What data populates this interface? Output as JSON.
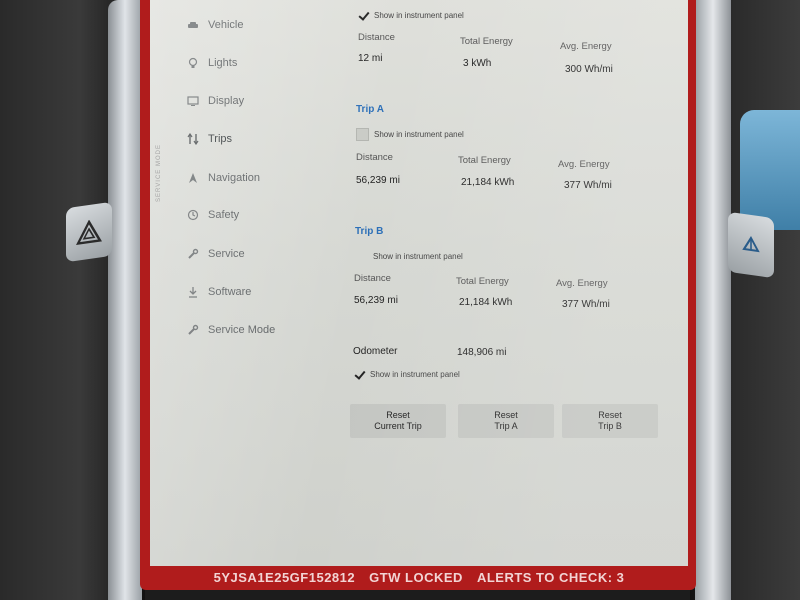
{
  "status_bar": {
    "vin": "5YJSA1E25GF152812",
    "gateway": "GTW LOCKED",
    "alerts": "ALERTS TO CHECK: 3"
  },
  "side_rail_text": "SERVICE MODE",
  "sidebar": {
    "items": [
      {
        "label": "Vehicle",
        "icon": "car-icon"
      },
      {
        "label": "Lights",
        "icon": "light-bulb-icon"
      },
      {
        "label": "Display",
        "icon": "display-icon"
      },
      {
        "label": "Trips",
        "icon": "trips-icon",
        "active": true
      },
      {
        "label": "Navigation",
        "icon": "navigation-arrow-icon"
      },
      {
        "label": "Safety",
        "icon": "safety-icon"
      },
      {
        "label": "Service",
        "icon": "wrench-icon"
      },
      {
        "label": "Software",
        "icon": "download-icon"
      },
      {
        "label": "Service Mode",
        "icon": "service-wrench-icon"
      }
    ]
  },
  "since_last_charge": {
    "show_label": "Show in instrument panel",
    "show_checked": true,
    "headers": {
      "distance": "Distance",
      "energy": "Total Energy",
      "avg": "Avg. Energy"
    },
    "values": {
      "distance": "12 mi",
      "energy": "3 kWh",
      "avg": "300 Wh/mi"
    }
  },
  "trip_a": {
    "title": "Trip A",
    "show_label": "Show in instrument panel",
    "show_checked": false,
    "headers": {
      "distance": "Distance",
      "energy": "Total Energy",
      "avg": "Avg. Energy"
    },
    "values": {
      "distance": "56,239 mi",
      "energy": "21,184 kWh",
      "avg": "377 Wh/mi"
    }
  },
  "trip_b": {
    "title": "Trip B",
    "show_label": "Show in instrument panel",
    "show_checked": false,
    "headers": {
      "distance": "Distance",
      "energy": "Total Energy",
      "avg": "Avg. Energy"
    },
    "values": {
      "distance": "56,239 mi",
      "energy": "21,184 kWh",
      "avg": "377 Wh/mi"
    }
  },
  "odometer": {
    "label": "Odometer",
    "value": "148,906 mi",
    "show_label": "Show in instrument panel",
    "show_checked": true
  },
  "buttons": {
    "reset_current": {
      "line1": "Reset",
      "line2": "Current Trip"
    },
    "reset_a": {
      "line1": "Reset",
      "line2": "Trip A"
    },
    "reset_b": {
      "line1": "Reset",
      "line2": "Trip B"
    }
  },
  "colors": {
    "frame": "#b01c1c",
    "trip_title": "#2c6fb8",
    "screen_bg": "#d6d8d3"
  }
}
